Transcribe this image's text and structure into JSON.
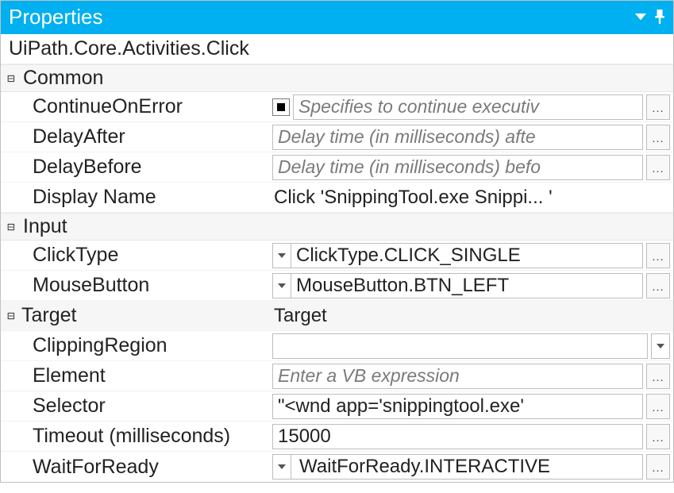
{
  "header": {
    "title": "Properties"
  },
  "activity_title": "UiPath.Core.Activities.Click",
  "sections": {
    "common": {
      "label": "Common",
      "continueOnError": {
        "label": "ContinueOnError",
        "placeholder": "Specifies to continue executiv"
      },
      "delayAfter": {
        "label": "DelayAfter",
        "placeholder": "Delay time (in milliseconds) afte"
      },
      "delayBefore": {
        "label": "DelayBefore",
        "placeholder": "Delay time (in milliseconds) befo"
      },
      "displayName": {
        "label": "Display Name",
        "value": "Click 'SnippingTool.exe Snippi... '"
      }
    },
    "input": {
      "label": "Input",
      "clickType": {
        "label": "ClickType",
        "value": "ClickType.CLICK_SINGLE"
      },
      "mouseButton": {
        "label": "MouseButton",
        "value": "MouseButton.BTN_LEFT"
      },
      "target": {
        "label": "Target",
        "value": "Target",
        "clippingRegion": {
          "label": "ClippingRegion",
          "value": ""
        },
        "element": {
          "label": "Element",
          "placeholder": "Enter a VB expression"
        },
        "selector": {
          "label": "Selector",
          "value": "\"<wnd app='snippingtool.exe' "
        },
        "timeout": {
          "label": "Timeout (milliseconds)",
          "value": "15000"
        },
        "waitForReady": {
          "label": "WaitForReady",
          "value": "WaitForReady.INTERACTIVE"
        }
      }
    }
  }
}
